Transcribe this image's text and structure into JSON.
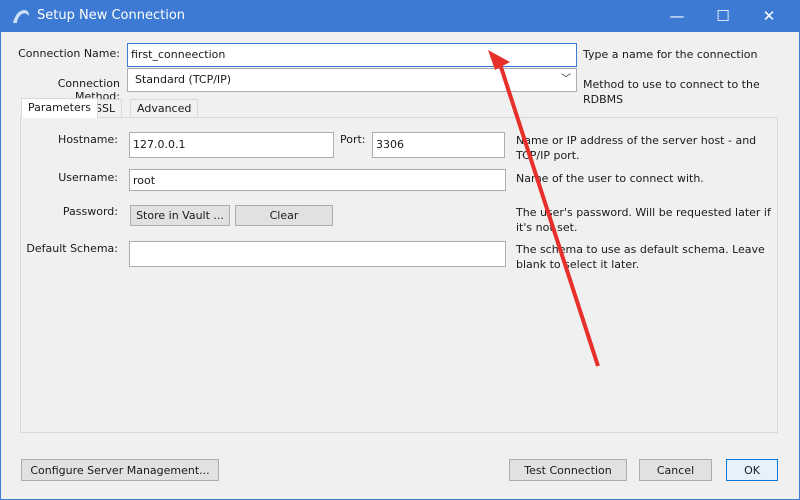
{
  "window": {
    "title": "Setup New Connection",
    "app_icon": "mysql-dolphin-icon",
    "minimize": "—",
    "maximize": "☐",
    "close": "✕"
  },
  "connection_name": {
    "label": "Connection Name:",
    "value": "first_conneection",
    "hint": "Type a name for the connection"
  },
  "connection_method": {
    "label": "Connection Method:",
    "value": "Standard (TCP/IP)",
    "hint": "Method to use to connect to the RDBMS"
  },
  "tabs": [
    {
      "label": "Parameters",
      "active": true
    },
    {
      "label": "SSL"
    },
    {
      "label": "Advanced"
    }
  ],
  "params": {
    "hostname": {
      "label": "Hostname:",
      "value": "127.0.0.1"
    },
    "port": {
      "label": "Port:",
      "value": "3306"
    },
    "hostname_hint": "Name or IP address of the server host - and TCP/IP port.",
    "username": {
      "label": "Username:",
      "value": "root",
      "hint": "Name of the user to connect with."
    },
    "password": {
      "label": "Password:",
      "store": "Store in Vault ...",
      "clear": "Clear",
      "hint": "The user's password. Will be requested later if it's not set."
    },
    "schema": {
      "label": "Default Schema:",
      "value": "",
      "hint": "The schema to use as default schema. Leave blank to select it later."
    }
  },
  "footer": {
    "configure": "Configure Server Management...",
    "test": "Test Connection",
    "cancel": "Cancel",
    "ok": "OK"
  },
  "annotation_color": "#e8302a"
}
